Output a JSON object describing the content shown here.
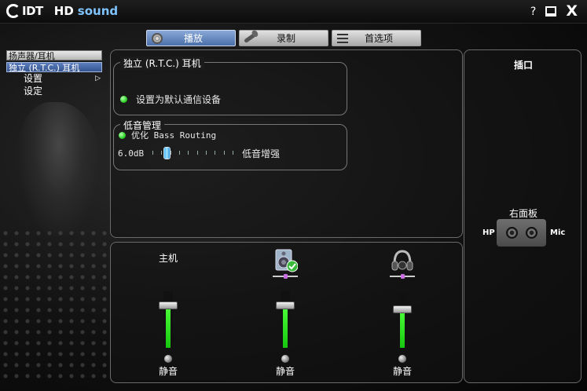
{
  "app": {
    "brand": "IDT",
    "product_bold": "HD",
    "product_rest": "sound",
    "help": "?",
    "close": "X"
  },
  "tabs": [
    {
      "label": "播放",
      "icon": "speaker-icon",
      "active": true
    },
    {
      "label": "录制",
      "icon": "microphone-icon",
      "active": false
    },
    {
      "label": "首选项",
      "icon": "preferences-icon",
      "active": false
    }
  ],
  "nav": {
    "devices": [
      "扬声器/耳机",
      "独立 (R.T.C.) 耳机"
    ],
    "sub_items": [
      "设置",
      "设定"
    ],
    "arrow": "▷"
  },
  "rtc_group": {
    "title": "独立 (R.T.C.) 耳机",
    "default_device_label": "设置为默认通信设备"
  },
  "bass_group": {
    "title": "低音管理",
    "optimize_label": "优化 Bass Routing",
    "gain_value": "6.0dB",
    "slider_position": 0.18,
    "boost_label": "低音增强"
  },
  "volume": {
    "channels": [
      {
        "title": "主机",
        "icon": null,
        "level": 0.75,
        "mute_label": "静音"
      },
      {
        "title": "",
        "icon": "speaker-device-icon",
        "level": 0.75,
        "mute_label": "静音"
      },
      {
        "title": "",
        "icon": "headphone-device-icon",
        "level": 0.68,
        "mute_label": "静音"
      }
    ]
  },
  "ports": {
    "title": "插口",
    "panel_label": "右面板",
    "hp_label": "HP",
    "mic_label": "Mic"
  },
  "colors": {
    "tab_active": "#4a6ea8",
    "level_green": "#18c70f",
    "led_green": "#2fd32a",
    "slider_blue": "#3fb7ff"
  }
}
